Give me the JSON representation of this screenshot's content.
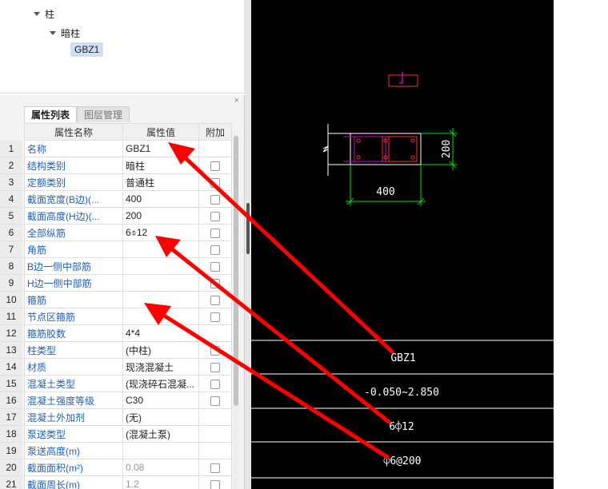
{
  "tree": {
    "column_node": "柱",
    "hidden_column_node": "暗柱",
    "selected_element": "GBZ1"
  },
  "panel": {
    "close_glyph": "×",
    "tabs": [
      {
        "label": "属性列表",
        "active": true
      },
      {
        "label": "图层管理",
        "active": false
      }
    ]
  },
  "table": {
    "headers": {
      "name": "属性名称",
      "value": "属性值",
      "extra": "附加"
    },
    "rows": [
      {
        "num": "1",
        "name": "名称",
        "value": "GBZ1",
        "checkbox": false
      },
      {
        "num": "2",
        "name": "结构类别",
        "value": "暗柱",
        "checkbox": true
      },
      {
        "num": "3",
        "name": "定额类别",
        "value": "普通柱",
        "checkbox": true
      },
      {
        "num": "4",
        "name": "截面宽度(B边)(...",
        "value": "400",
        "checkbox": true
      },
      {
        "num": "5",
        "name": "截面高度(H边)(...",
        "value": "200",
        "checkbox": true
      },
      {
        "num": "6",
        "name": "全部纵筋",
        "value": "6⌽12",
        "checkbox": true
      },
      {
        "num": "7",
        "name": "角筋",
        "value": "",
        "checkbox": true
      },
      {
        "num": "8",
        "name": "B边一侧中部筋",
        "value": "",
        "checkbox": true
      },
      {
        "num": "9",
        "name": "H边一侧中部筋",
        "value": "",
        "checkbox": true
      },
      {
        "num": "10",
        "name": "箍筋",
        "value": "",
        "checkbox": true
      },
      {
        "num": "11",
        "name": "节点区箍筋",
        "value": "",
        "checkbox": true
      },
      {
        "num": "12",
        "name": "箍筋胶数",
        "value": "4*4",
        "checkbox": false
      },
      {
        "num": "13",
        "name": "柱类型",
        "value": "(中柱)",
        "checkbox": true
      },
      {
        "num": "14",
        "name": "材质",
        "value": "现浇混凝土",
        "checkbox": true
      },
      {
        "num": "15",
        "name": "混凝土类型",
        "value": "(现浇碎石混凝...",
        "checkbox": true
      },
      {
        "num": "16",
        "name": "混凝土强度等级",
        "value": "C30",
        "checkbox": true
      },
      {
        "num": "17",
        "name": "混凝土外加剂",
        "value": "(无)",
        "checkbox": false
      },
      {
        "num": "18",
        "name": "泵送类型",
        "value": "(混凝土泵)",
        "checkbox": false
      },
      {
        "num": "19",
        "name": "泵送高度(m)",
        "value": "",
        "checkbox": false
      },
      {
        "num": "20",
        "name": "截面面积(m²)",
        "value": "0.08",
        "checkbox": true
      },
      {
        "num": "21",
        "name": "截面周长(m)",
        "value": "1.2",
        "checkbox": true
      }
    ]
  },
  "cad": {
    "dim_width": "400",
    "dim_height": "200",
    "table_texts": [
      "GBZ1",
      "-0.050~2.850",
      "6⌽12",
      "⌽6@200"
    ]
  },
  "colors": {
    "annotation_arrow": "#ff0000",
    "cad_white": "#ffffff",
    "cad_green": "#00e000",
    "cad_red": "#ff3030",
    "cad_magenta": "#d000d0",
    "property_name_blue": "#1f5fbf"
  }
}
